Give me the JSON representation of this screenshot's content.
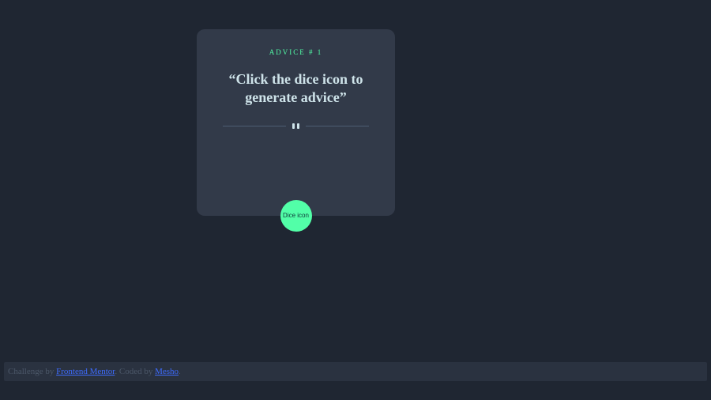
{
  "card": {
    "heading_prefix": "ADVICE # ",
    "id": "1",
    "quote": "“Click the dice icon to generate advice”"
  },
  "dice_button_alt": "Dice icon",
  "footer": {
    "challenge_by": "Challenge by ",
    "fm": "Frontend Mentor",
    "coded_by": ". Coded by ",
    "author": "Mesho",
    "trail": "."
  }
}
